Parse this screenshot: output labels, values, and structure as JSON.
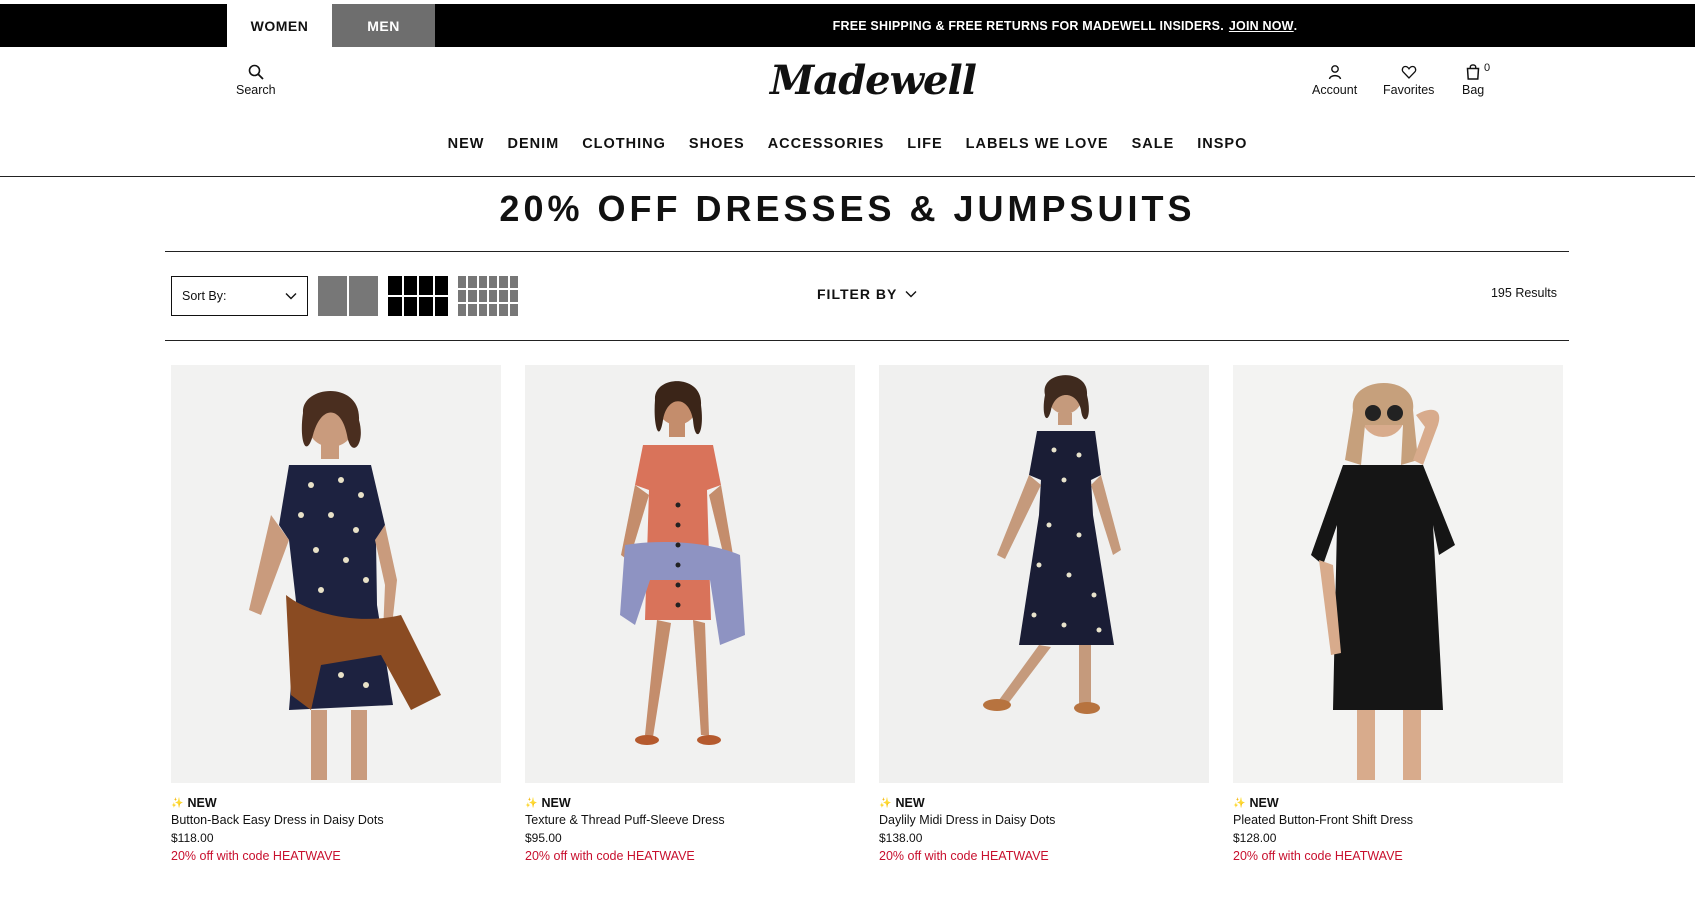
{
  "top_bar": {
    "tabs": [
      {
        "label": "WOMEN",
        "active": true
      },
      {
        "label": "MEN",
        "active": false
      }
    ],
    "promo_text": "FREE SHIPPING & FREE RETURNS FOR MADEWELL INSIDERS.",
    "promo_link": "JOIN NOW",
    "promo_suffix": "."
  },
  "header": {
    "logo": "Madewell",
    "search_label": "Search",
    "account_label": "Account",
    "favorites_label": "Favorites",
    "bag_label": "Bag",
    "bag_count": "0",
    "icons": {
      "search": "search-icon",
      "account": "user-icon",
      "favorites": "heart-icon",
      "bag": "shopping-bag-icon"
    }
  },
  "nav": {
    "items": [
      "NEW",
      "DENIM",
      "CLOTHING",
      "SHOES",
      "ACCESSORIES",
      "LIFE",
      "LABELS WE LOVE",
      "SALE",
      "INSPO"
    ]
  },
  "page": {
    "title": "20% OFF DRESSES & JUMPSUITS"
  },
  "toolbar": {
    "sort_label": "Sort By:",
    "filter_label": "FILTER BY",
    "results": "195 Results",
    "grid_options": [
      "2-column",
      "4-column",
      "6-column"
    ],
    "active_grid": "4-column"
  },
  "products": [
    {
      "badge": "NEW",
      "name": "Button-Back Easy Dress in Daisy Dots",
      "price": "$118.00",
      "promo": "20% off with code HEATWAVE",
      "dress_color": "#1d2240"
    },
    {
      "badge": "NEW",
      "name": "Texture & Thread Puff-Sleeve Dress",
      "price": "$95.00",
      "promo": "20% off with code HEATWAVE",
      "dress_color": "#d9735a"
    },
    {
      "badge": "NEW",
      "name": "Daylily Midi Dress in Daisy Dots",
      "price": "$138.00",
      "promo": "20% off with code HEATWAVE",
      "dress_color": "#1a1d35"
    },
    {
      "badge": "NEW",
      "name": "Pleated Button-Front Shift Dress",
      "price": "$128.00",
      "promo": "20% off with code HEATWAVE",
      "dress_color": "#151515"
    }
  ],
  "colors": {
    "promo_red": "#c8102e",
    "topbar_black": "#000000",
    "men_tab_gray": "#6e6e6e"
  }
}
